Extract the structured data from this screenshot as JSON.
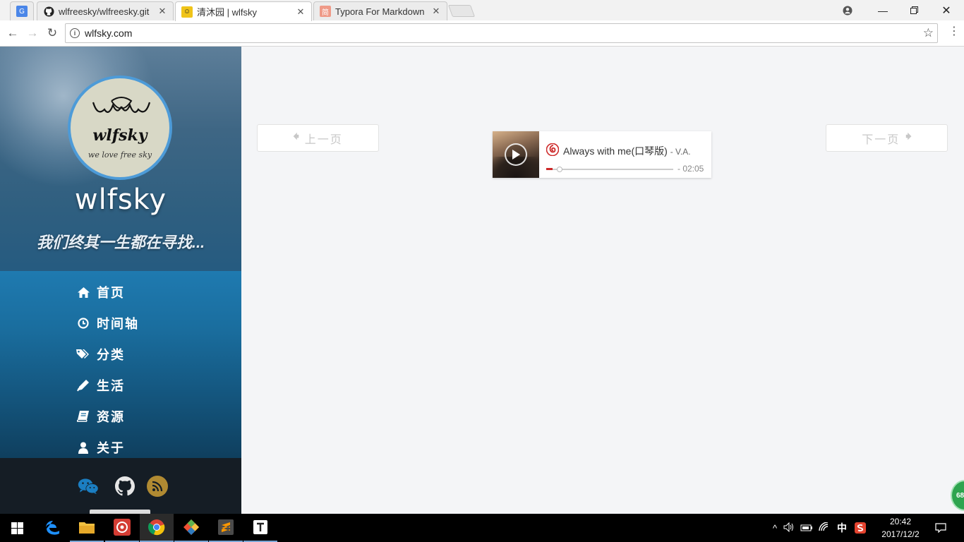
{
  "browser": {
    "tabs": [
      {
        "title": "",
        "favicon": "google-translate-icon"
      },
      {
        "title": "wlfreesky/wlfreesky.git",
        "favicon": "github-icon"
      },
      {
        "title": "清沐园 | wlfsky",
        "favicon": "avatar-favicon"
      },
      {
        "title": "Typora For Markdown",
        "favicon": "jianshu-icon",
        "favicon_text": "简"
      }
    ],
    "url": "wlfsky.com"
  },
  "site": {
    "avatar_logo": "wlfsky",
    "avatar_slogan": "we love free sky",
    "title": "wlfsky",
    "tagline": "我们终其一生都在寻找..."
  },
  "menu": [
    {
      "label": "首页",
      "icon": "home-icon"
    },
    {
      "label": "时间轴",
      "icon": "clock-icon"
    },
    {
      "label": "分类",
      "icon": "tags-icon"
    },
    {
      "label": "生活",
      "icon": "pencil-icon"
    },
    {
      "label": "资源",
      "icon": "book-icon"
    },
    {
      "label": "关于",
      "icon": "user-icon"
    }
  ],
  "socials": [
    "wechat-icon",
    "github-icon",
    "rss-icon"
  ],
  "pager": {
    "prev_label": "上一页",
    "next_label": "下一页"
  },
  "player": {
    "song": "Always with me(口琴版)",
    "artist": "- V.A.",
    "time": "- 02:05",
    "progress": 0.05
  },
  "float_badge": "68",
  "taskbar": {
    "apps": [
      "windows-start-icon",
      "edge-icon",
      "file-explorer-icon",
      "netease-music-icon",
      "chrome-icon",
      "git-icon",
      "sublime-text-icon",
      "typora-icon"
    ],
    "ime": "中",
    "time": "20:42",
    "date": "2017/12/2"
  },
  "colors": {
    "accent_blue": "#4d9bd8",
    "netease_red": "#cd2929",
    "rss_gold": "#b08a32"
  }
}
